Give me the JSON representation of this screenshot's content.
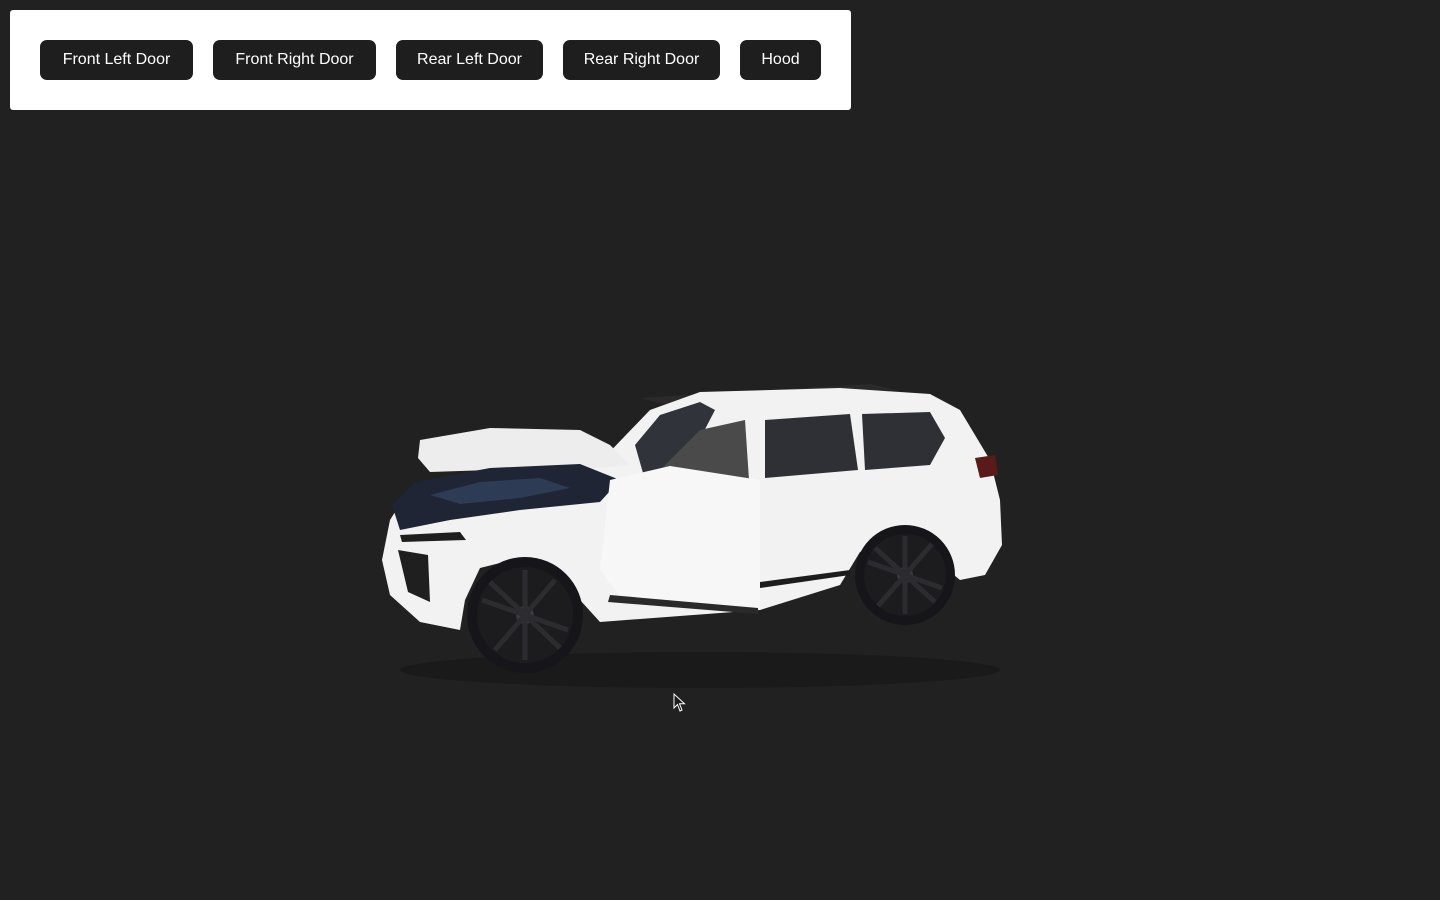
{
  "controls": {
    "buttons": [
      {
        "label": "Front Left Door"
      },
      {
        "label": "Front Right Door"
      },
      {
        "label": "Rear Left Door"
      },
      {
        "label": "Rear Right Door"
      },
      {
        "label": "Hood"
      }
    ]
  },
  "scene": {
    "background_color": "#212121",
    "model": "white-suv-icon",
    "car_color": "#f4f4f4",
    "wheel_color": "#1c1c1f"
  },
  "cursor": {
    "icon": "mouse-pointer-icon"
  }
}
